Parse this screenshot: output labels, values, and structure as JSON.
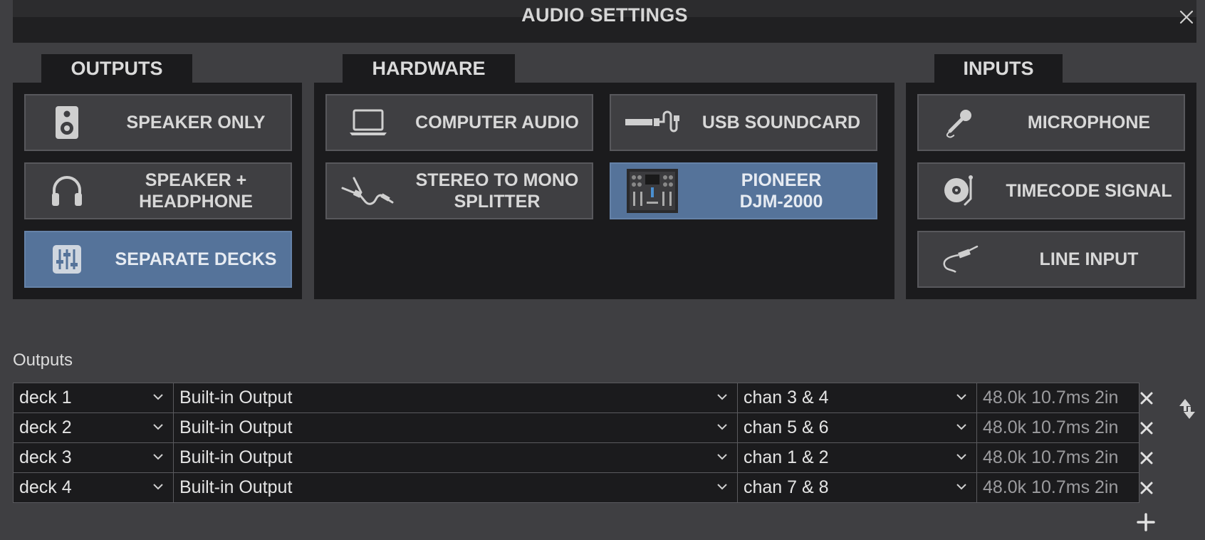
{
  "window": {
    "title": "AUDIO SETTINGS"
  },
  "tabs": {
    "outputs": "OUTPUTS",
    "hardware": "HARDWARE",
    "inputs": "INPUTS"
  },
  "outputs_tiles": [
    {
      "label": "SPEAKER ONLY",
      "icon": "speaker-icon",
      "active": false
    },
    {
      "label": "SPEAKER +\nHEADPHONE",
      "icon": "headphones-icon",
      "active": false
    },
    {
      "label": "SEPARATE DECKS",
      "icon": "mixer-sliders-icon",
      "active": true
    }
  ],
  "hardware_tiles": [
    {
      "label": "COMPUTER AUDIO",
      "icon": "laptop-icon",
      "active": false
    },
    {
      "label": "USB SOUNDCARD",
      "icon": "usb-cable-icon",
      "active": false
    },
    {
      "label": "STEREO TO MONO\nSPLITTER",
      "icon": "splitter-cable-icon",
      "active": false
    },
    {
      "label": "PIONEER\nDJM-2000",
      "icon": "dj-mixer-thumbnail",
      "active": true
    }
  ],
  "inputs_tiles": [
    {
      "label": "MICROPHONE",
      "icon": "microphone-icon",
      "active": false
    },
    {
      "label": "TIMECODE SIGNAL",
      "icon": "turntable-icon",
      "active": false
    },
    {
      "label": "LINE INPUT",
      "icon": "jack-cable-icon",
      "active": false
    }
  ],
  "outputs_section": {
    "label": "Outputs",
    "rows": [
      {
        "deck": "deck 1",
        "device": "Built-in Output",
        "channels": "chan 3 & 4",
        "info": "48.0k 10.7ms 2in"
      },
      {
        "deck": "deck 2",
        "device": "Built-in Output",
        "channels": "chan 5 & 6",
        "info": "48.0k 10.7ms 2in"
      },
      {
        "deck": "deck 3",
        "device": "Built-in Output",
        "channels": "chan 1 & 2",
        "info": "48.0k 10.7ms 2in"
      },
      {
        "deck": "deck 4",
        "device": "Built-in Output",
        "channels": "chan 7 & 8",
        "info": "48.0k 10.7ms 2in"
      }
    ]
  },
  "colors": {
    "background": "#3f3f42",
    "panel": "#1b1b1d",
    "active_tile": "#55739a",
    "text": "#d8d8d8"
  }
}
